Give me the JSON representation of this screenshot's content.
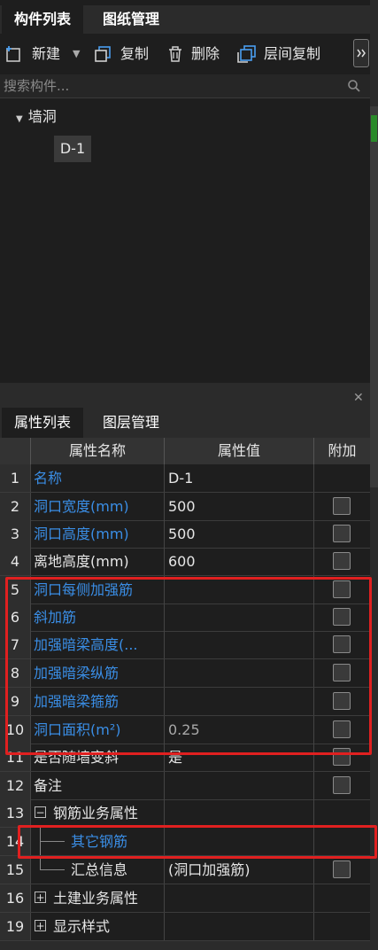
{
  "top_tabs": [
    "构件列表",
    "图纸管理"
  ],
  "toolbar": {
    "new_label": "新建",
    "copy_label": "复制",
    "delete_label": "删除",
    "floor_copy_label": "层间复制"
  },
  "search": {
    "placeholder": "搜索构件..."
  },
  "tree": {
    "parent": "墙洞",
    "child": "D-1"
  },
  "bottom_tabs": [
    "属性列表",
    "图层管理"
  ],
  "table": {
    "headers": [
      "属性名称",
      "属性值",
      "附加"
    ],
    "rows": [
      {
        "num": "1",
        "name": "名称",
        "value": "D-1"
      },
      {
        "num": "2",
        "name": "洞口宽度(mm)",
        "value": "500"
      },
      {
        "num": "3",
        "name": "洞口高度(mm)",
        "value": "500"
      },
      {
        "num": "4",
        "name": "离地高度(mm)",
        "value": "600"
      },
      {
        "num": "5",
        "name": "洞口每侧加强筋",
        "value": ""
      },
      {
        "num": "6",
        "name": "斜加筋",
        "value": ""
      },
      {
        "num": "7",
        "name": "加强暗梁高度(...",
        "value": ""
      },
      {
        "num": "8",
        "name": "加强暗梁纵筋",
        "value": ""
      },
      {
        "num": "9",
        "name": "加强暗梁箍筋",
        "value": ""
      },
      {
        "num": "10",
        "name": "洞口面积(m²)",
        "value": "0.25"
      },
      {
        "num": "11",
        "name": "是否随墙变斜",
        "value": "是"
      },
      {
        "num": "12",
        "name": "备注",
        "value": ""
      },
      {
        "num": "13",
        "name": "钢筋业务属性",
        "value": ""
      },
      {
        "num": "14",
        "name": "其它钢筋",
        "value": ""
      },
      {
        "num": "15",
        "name": "汇总信息",
        "value": "(洞口加强筋)"
      },
      {
        "num": "16",
        "name": "土建业务属性",
        "value": ""
      },
      {
        "num": "19",
        "name": "显示样式",
        "value": ""
      }
    ]
  },
  "colors": {
    "blue": "#3a8ee6",
    "highlight_red": "#e02020"
  }
}
